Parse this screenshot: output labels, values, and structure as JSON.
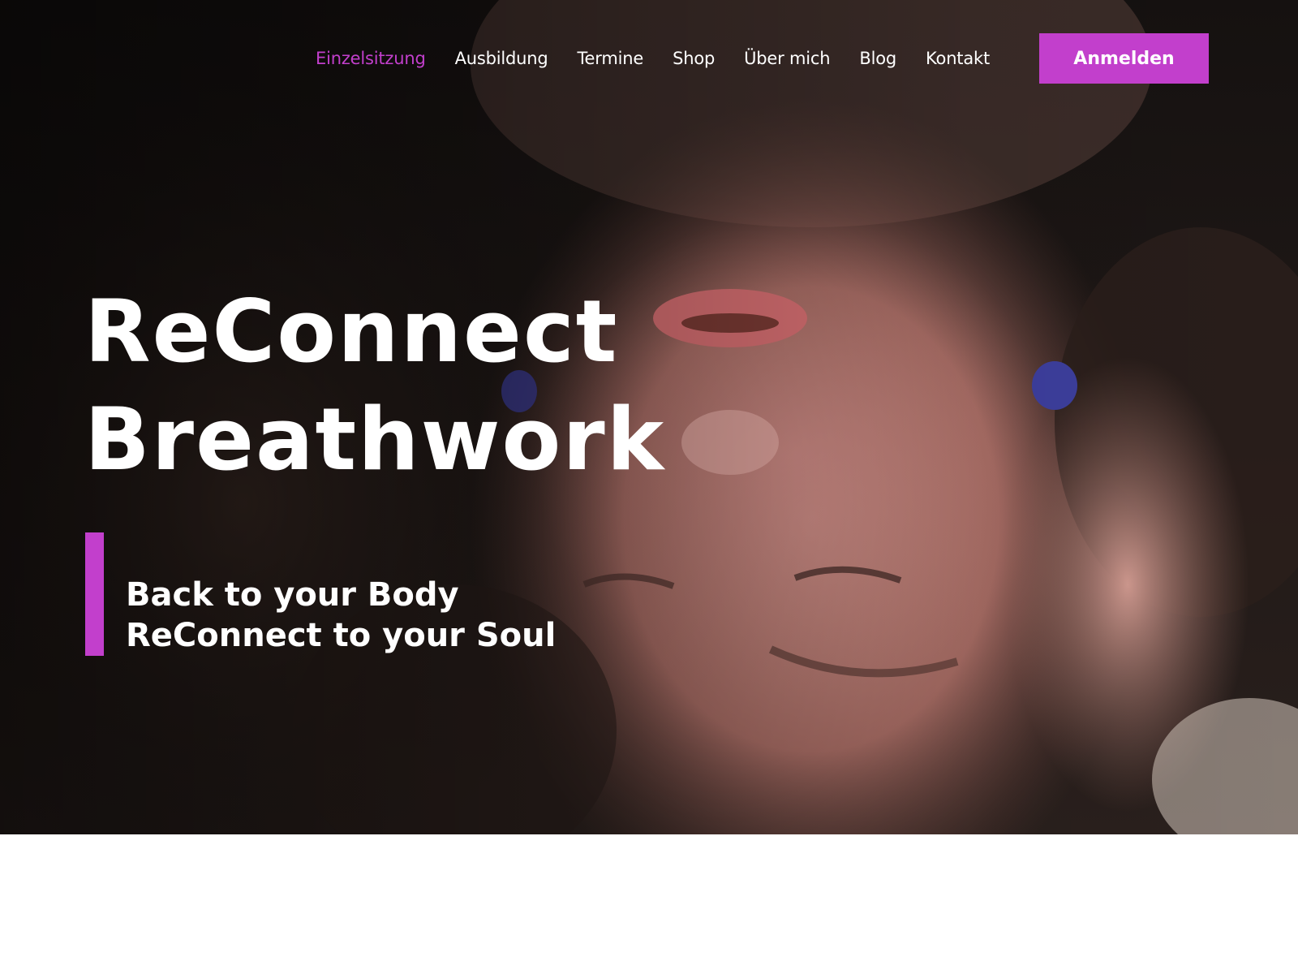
{
  "nav": {
    "items": [
      {
        "label": "Einzelsitzung",
        "active": true
      },
      {
        "label": "Ausbildung",
        "active": false
      },
      {
        "label": "Termine",
        "active": false
      },
      {
        "label": "Shop",
        "active": false
      },
      {
        "label": "Über mich",
        "active": false
      },
      {
        "label": "Blog",
        "active": false
      },
      {
        "label": "Kontakt",
        "active": false
      }
    ],
    "login_label": "Anmelden"
  },
  "hero": {
    "title_line1": "ReConnect",
    "title_line2": "Breathwork",
    "tagline_line1": "Back to your Body",
    "tagline_line2": "ReConnect to your Soul",
    "image_subject": "upside-down face of a person with closed eyes held by hands with blue nail polish"
  },
  "colors": {
    "accent": "#c23fcc",
    "text_on_dark": "#ffffff",
    "page_background": "#ffffff"
  }
}
